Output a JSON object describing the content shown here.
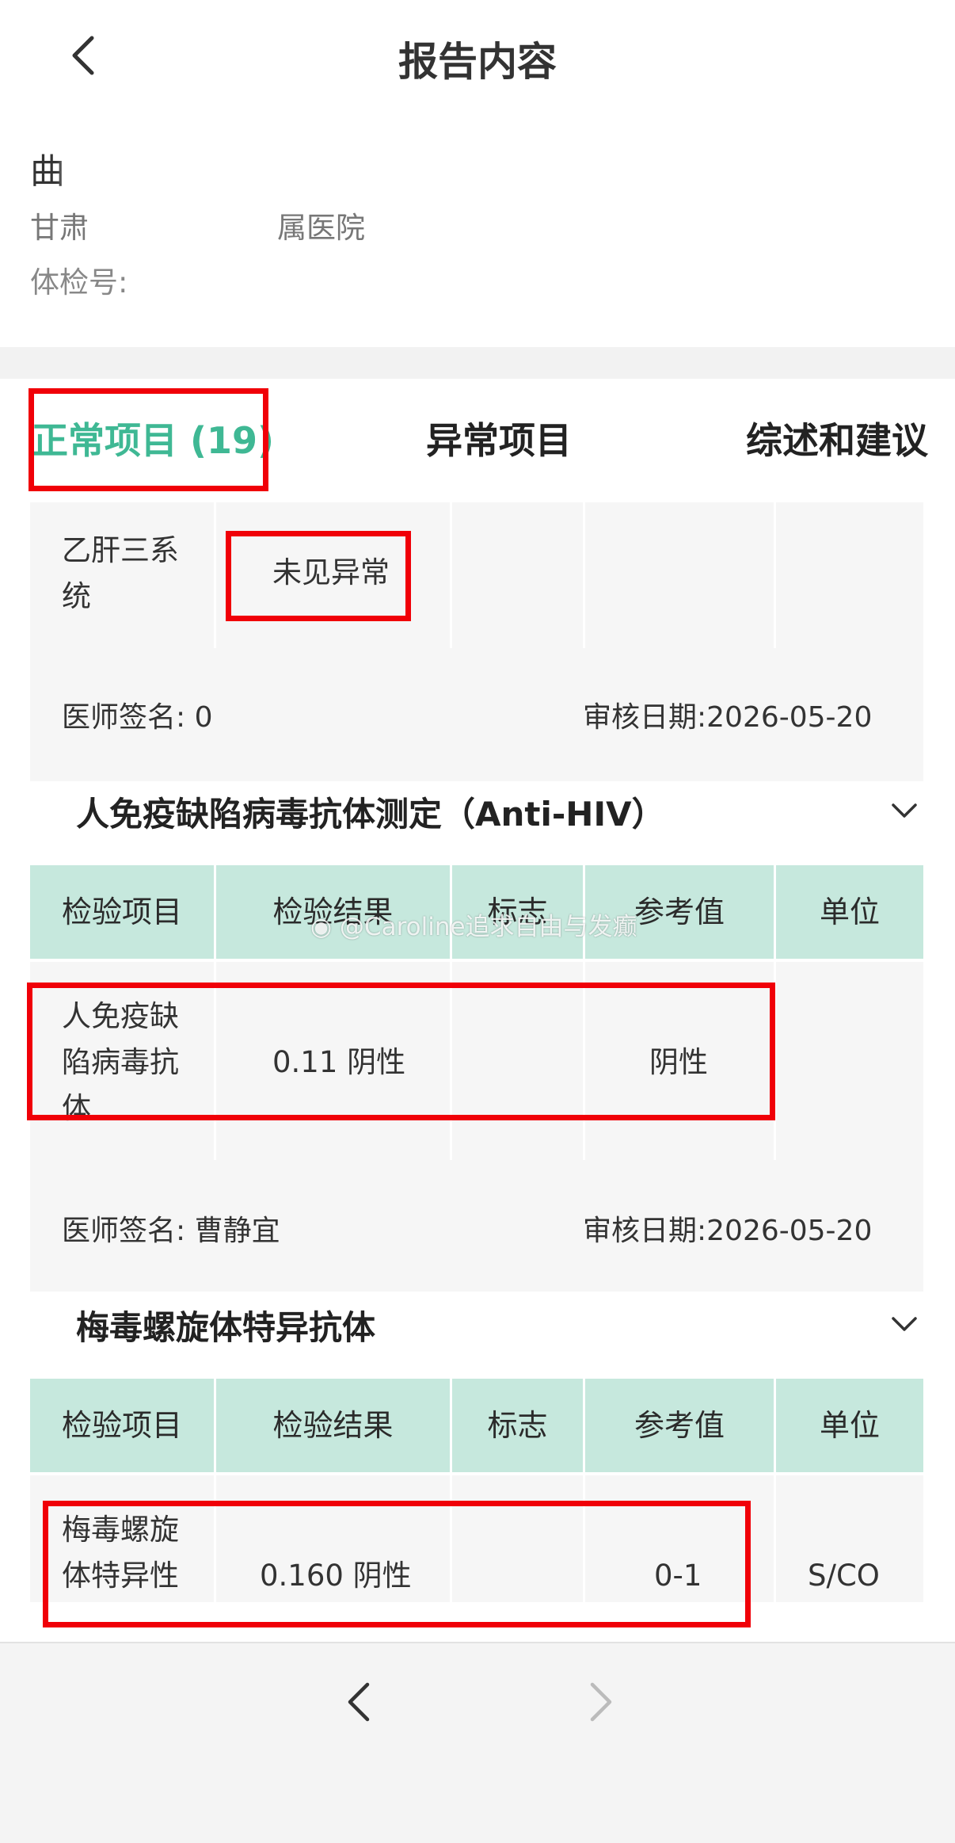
{
  "header": {
    "title": "报告内容"
  },
  "patient": {
    "name": "曲",
    "hospital_prefix": "甘肃",
    "hospital_suffix": "属医院",
    "exam_label": "体检号:"
  },
  "tabs": [
    {
      "label": "正常项目 (19)",
      "active": true
    },
    {
      "label": "异常项目",
      "active": false
    },
    {
      "label": "综述和建议",
      "active": false
    }
  ],
  "sections": [
    {
      "row": {
        "item": "乙肝三系统",
        "result": "未见异常",
        "flag": "",
        "reference": "",
        "unit": ""
      },
      "doctor_signature": "医师签名: 0",
      "review_date": "审核日期:2026-05-20"
    },
    {
      "title": "人免疫缺陷病毒抗体测定（Anti-HIV）",
      "columns": [
        "检验项目",
        "检验结果",
        "标志",
        "参考值",
        "单位"
      ],
      "row": {
        "item": "人免疫缺陷病毒抗体",
        "result": "0.11 阴性",
        "flag": "",
        "reference": "阴性",
        "unit": ""
      },
      "doctor_signature": "医师签名: 曹静宜",
      "review_date": "审核日期:2026-05-20"
    },
    {
      "title": "梅毒螺旋体特异抗体",
      "columns": [
        "检验项目",
        "检验结果",
        "标志",
        "参考值",
        "单位"
      ],
      "row": {
        "item": "梅毒螺旋体特异性",
        "result": "0.160 阴性",
        "flag": "",
        "reference": "0-1",
        "unit": "S/CO"
      }
    }
  ],
  "watermark": "@Caroline追求自由与发癫",
  "icons": {
    "back": "chevron-left-icon",
    "collapse": "chevron-down-icon",
    "prev": "chevron-left-icon",
    "next": "chevron-right-icon",
    "watermark": "weibo-logo-icon"
  },
  "colors": {
    "accent": "#3fb894",
    "table_header": "#c6e8dd",
    "annotation": "#f00008"
  }
}
